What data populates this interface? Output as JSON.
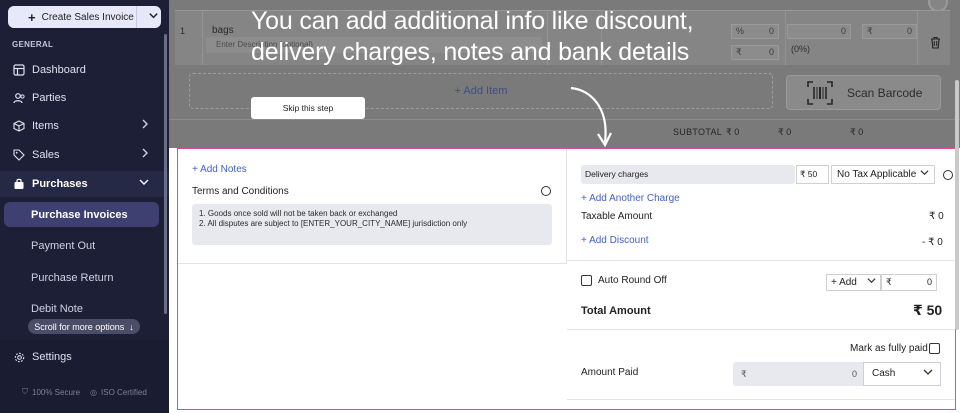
{
  "sidebar": {
    "create_button": "Create Sales Invoice",
    "section_label": "GENERAL",
    "items": [
      {
        "label": "Dashboard",
        "icon": "dashboard-icon"
      },
      {
        "label": "Parties",
        "icon": "users-icon"
      },
      {
        "label": "Items",
        "icon": "box-icon"
      },
      {
        "label": "Sales",
        "icon": "tag-icon"
      },
      {
        "label": "Purchases",
        "icon": "bag-icon"
      }
    ],
    "purchases_sub": [
      "Purchase Invoices",
      "Payment Out",
      "Purchase Return",
      "Debit Note"
    ],
    "scroll_tip": "Scroll for more options",
    "settings": "Settings",
    "secure": "100% Secure",
    "iso": "ISO Certified"
  },
  "item_row": {
    "index": "1",
    "name": "bags",
    "description_placeholder": "Enter Description (optional)",
    "discount_percent_symbol": "%",
    "discount_percent": "0",
    "discount_amount_symbol": "₹",
    "discount_amount": "0",
    "tax_label": "(0%)",
    "tax_value": "0",
    "amount_symbol": "₹",
    "amount": "0"
  },
  "add_item": "+ Add Item",
  "scan_barcode": "Scan Barcode",
  "subtotal": {
    "label": "SUBTOTAL",
    "values": [
      "₹ 0",
      "₹ 0",
      "₹ 0"
    ]
  },
  "tutorial": {
    "line1": "You can add additional info like discount,",
    "line2": "delivery charges, notes and bank details",
    "skip": "Skip this step"
  },
  "notes": {
    "add_notes": "+ Add Notes",
    "terms_title": "Terms and Conditions",
    "terms_lines": [
      "1. Goods once sold will not be taken back or exchanged",
      "2. All disputes are subject to [ENTER_YOUR_CITY_NAME] jurisdiction only"
    ]
  },
  "charges": {
    "delivery_label": "Delivery charges",
    "delivery_value": "₹ 50",
    "tax_option": "No Tax Applicable",
    "add_another": "+ Add Another Charge",
    "taxable_label": "Taxable Amount",
    "taxable_value": "₹ 0",
    "add_discount": "+ Add Discount",
    "discount_value": "- ₹ 0",
    "auto_round": "Auto Round Off",
    "add_option": "+ Add",
    "round_value": "₹",
    "round_amount": "0",
    "total_label": "Total Amount",
    "total_value": "₹ 50",
    "mark_paid": "Mark as fully paid",
    "amount_paid_label": "Amount Paid",
    "paid_symbol": "₹",
    "paid_value": "0",
    "payment_mode": "Cash"
  },
  "colors": {
    "sidebar_bg": "#1d1f36",
    "highlight_border": "#e0489a",
    "link": "#4361c2"
  }
}
